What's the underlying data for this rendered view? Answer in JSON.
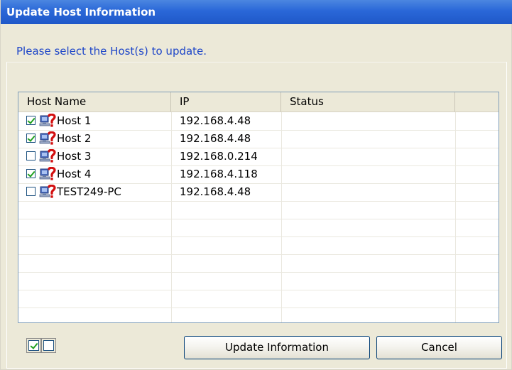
{
  "window": {
    "title": "Update Host Information"
  },
  "instruction": "Please select the Host(s) to update.",
  "list": {
    "columns": [
      "Host Name",
      "IP",
      "Status",
      ""
    ],
    "rows": [
      {
        "checked": true,
        "icon": "host-unknown-icon",
        "name": "Host 1",
        "ip": "192.168.4.48",
        "status": ""
      },
      {
        "checked": true,
        "icon": "host-unknown-icon",
        "name": "Host 2",
        "ip": "192.168.4.48",
        "status": ""
      },
      {
        "checked": false,
        "icon": "host-unknown-icon",
        "name": "Host 3",
        "ip": "192.168.0.214",
        "status": ""
      },
      {
        "checked": true,
        "icon": "host-unknown-icon",
        "name": "Host 4",
        "ip": "192.168.4.118",
        "status": ""
      },
      {
        "checked": false,
        "icon": "host-unknown-icon",
        "name": "TEST249-PC",
        "ip": "192.168.4.48",
        "status": ""
      }
    ]
  },
  "footer": {
    "select_all_icon": "checkbox-checked-icon",
    "select_none_icon": "checkbox-empty-icon",
    "update_label": "Update Information",
    "cancel_label": "Cancel"
  },
  "colors": {
    "title_bar": "#2a67d8",
    "window_bg": "#ECE9D8",
    "instruction_text": "#1e46c8",
    "check_green": "#21a121"
  }
}
